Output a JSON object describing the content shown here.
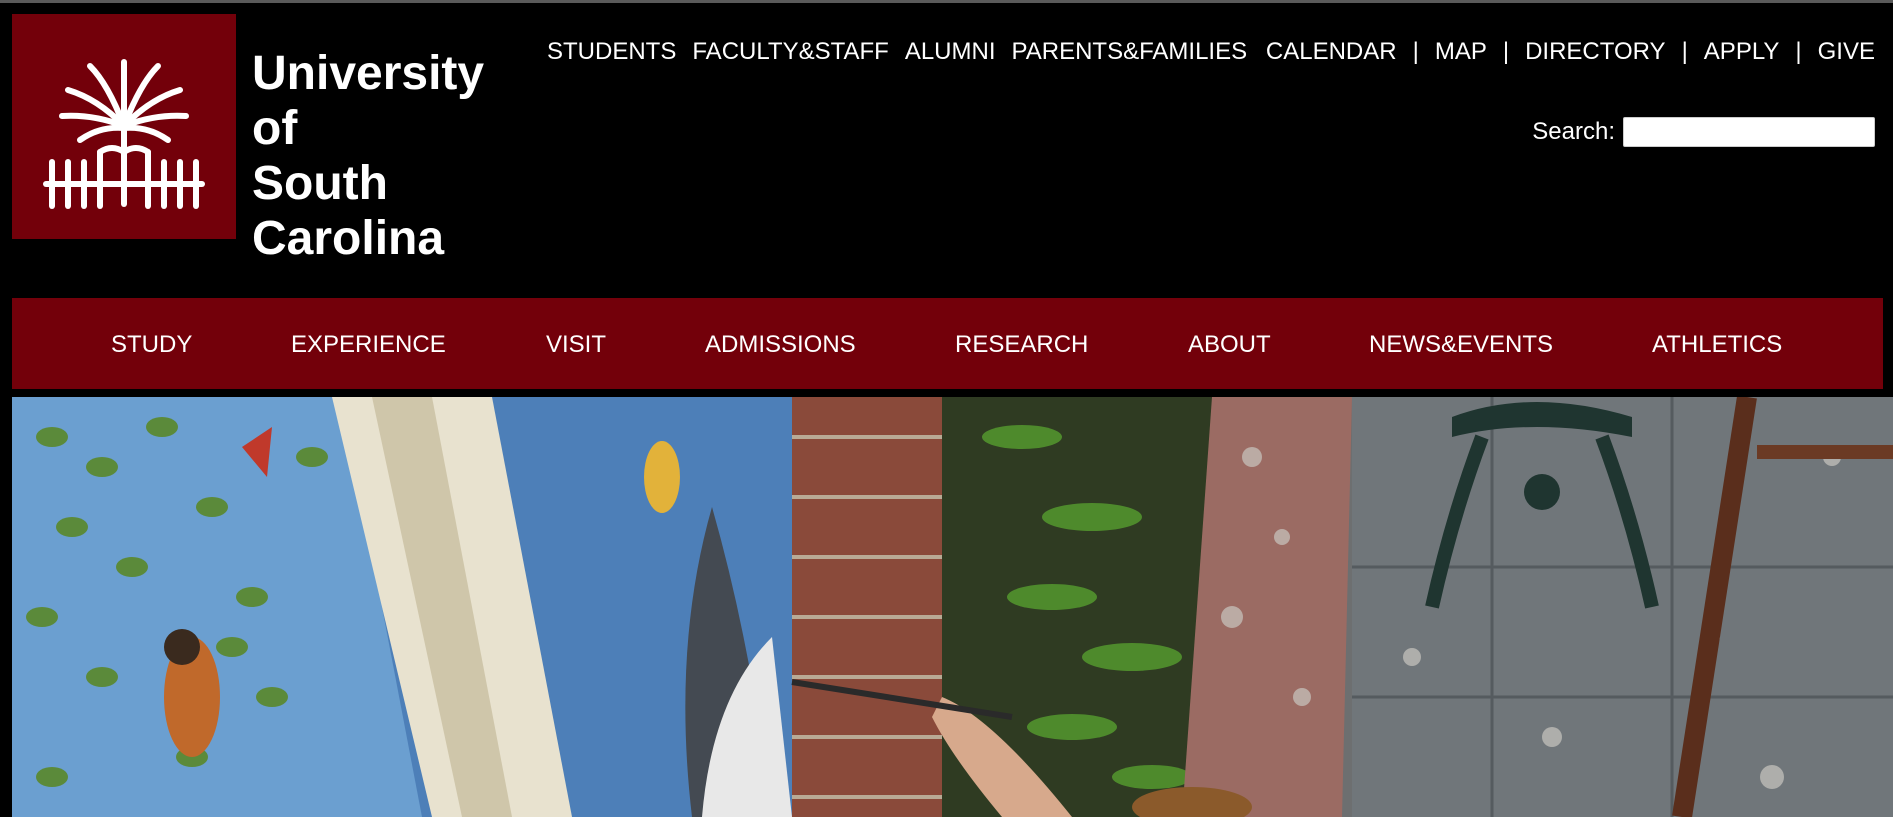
{
  "site": {
    "name_lines": [
      "University",
      "of",
      "South",
      "Carolina"
    ],
    "logo_icon": "palmetto-tree-logo"
  },
  "utility_nav": {
    "audiences": [
      "STUDENTS",
      "FACULTY&STAFF",
      "ALUMNI",
      "PARENTS&FAMILIES"
    ],
    "tools": [
      "CALENDAR",
      "MAP",
      "DIRECTORY",
      "APPLY",
      "GIVE"
    ],
    "separator": "|"
  },
  "search": {
    "label": "Search:",
    "value": "",
    "placeholder": ""
  },
  "main_nav": {
    "items": [
      "STUDY",
      "EXPERIENCE",
      "VISIT",
      "ADMISSIONS",
      "RESEARCH",
      "ABOUT",
      "NEWS&EVENTS",
      "ATHLETICS"
    ]
  },
  "colors": {
    "garnet": "#73000a",
    "header_bg": "#000000",
    "text": "#ffffff"
  },
  "hero": {
    "image": "photo-artist-painting-mural-on-brick-wall"
  }
}
